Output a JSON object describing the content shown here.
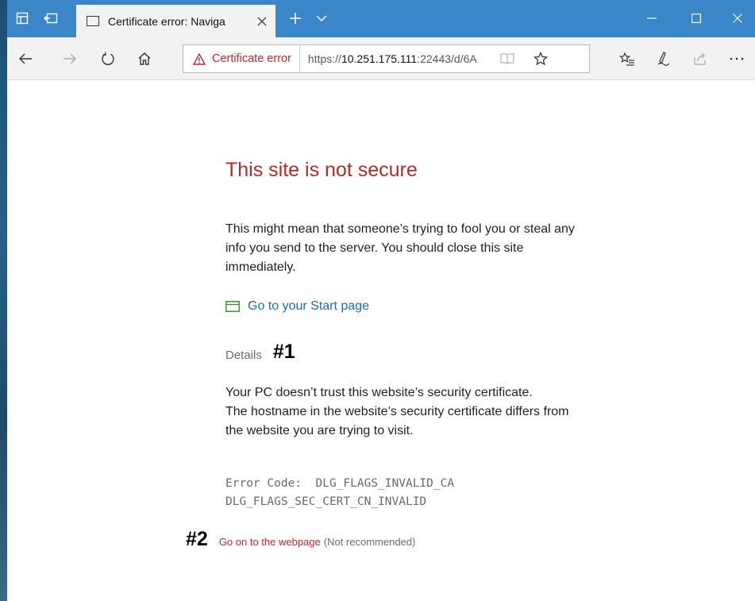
{
  "tab": {
    "title": "Certificate error: Naviga"
  },
  "address_bar": {
    "cert_warning": "Certificate error",
    "url_prefix": "https://",
    "url_host": "10.251.175.111",
    "url_rest": ":22443/d/6A"
  },
  "page": {
    "title": "This site is not secure",
    "message": "This might mean that someone’s trying to fool you or steal any info you send to the server. You should close this site immediately.",
    "start_page_link": "Go to your Start page",
    "details_label": "Details",
    "details_line1": "Your PC doesn’t trust this website’s security certificate.",
    "details_line2": "The hostname in the website’s security certificate differs from the website you are trying to visit.",
    "error_code_line1": "Error Code:  DLG_FLAGS_INVALID_CA",
    "error_code_line2": "DLG_FLAGS_SEC_CERT_CN_INVALID",
    "go_on_link": "Go on to the webpage",
    "go_on_note": "(Not recommended)"
  },
  "annotations": {
    "marker1": "#1",
    "marker2": "#2"
  },
  "colors": {
    "titlebar": "#3b86c9",
    "warning_red": "#c4262e",
    "link_blue": "#1b6ac6"
  }
}
